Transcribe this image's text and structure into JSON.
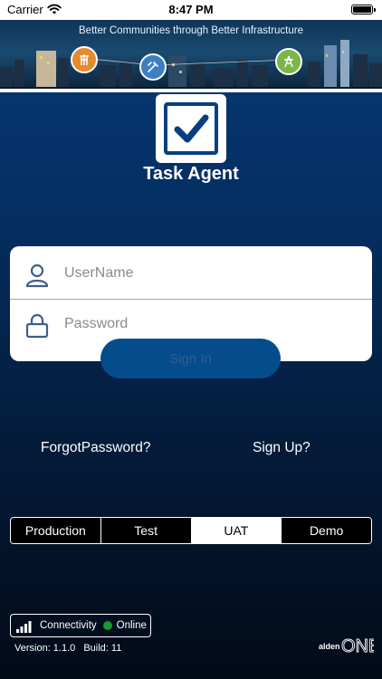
{
  "status_bar": {
    "carrier": "Carrier",
    "time": "8:47 PM"
  },
  "banner": {
    "tagline": "Better Communities through Better Infrastructure"
  },
  "app": {
    "title": "Task Agent"
  },
  "login": {
    "username_placeholder": "UserName",
    "password_placeholder": "Password",
    "signin_label": "Sign In"
  },
  "links": {
    "forgot_password": "ForgotPassword?",
    "sign_up": "Sign Up?"
  },
  "environments": {
    "tabs": [
      "Production",
      "Test",
      "UAT",
      "Demo"
    ],
    "selected": "UAT"
  },
  "connectivity": {
    "label": "Connectivity",
    "status": "Online",
    "status_color": "#1a9b2f"
  },
  "version": {
    "version": "Version: 1.1.0",
    "build": "Build: 11"
  },
  "brand": {
    "name": "aldenONE",
    "accent": "#054c8d"
  }
}
